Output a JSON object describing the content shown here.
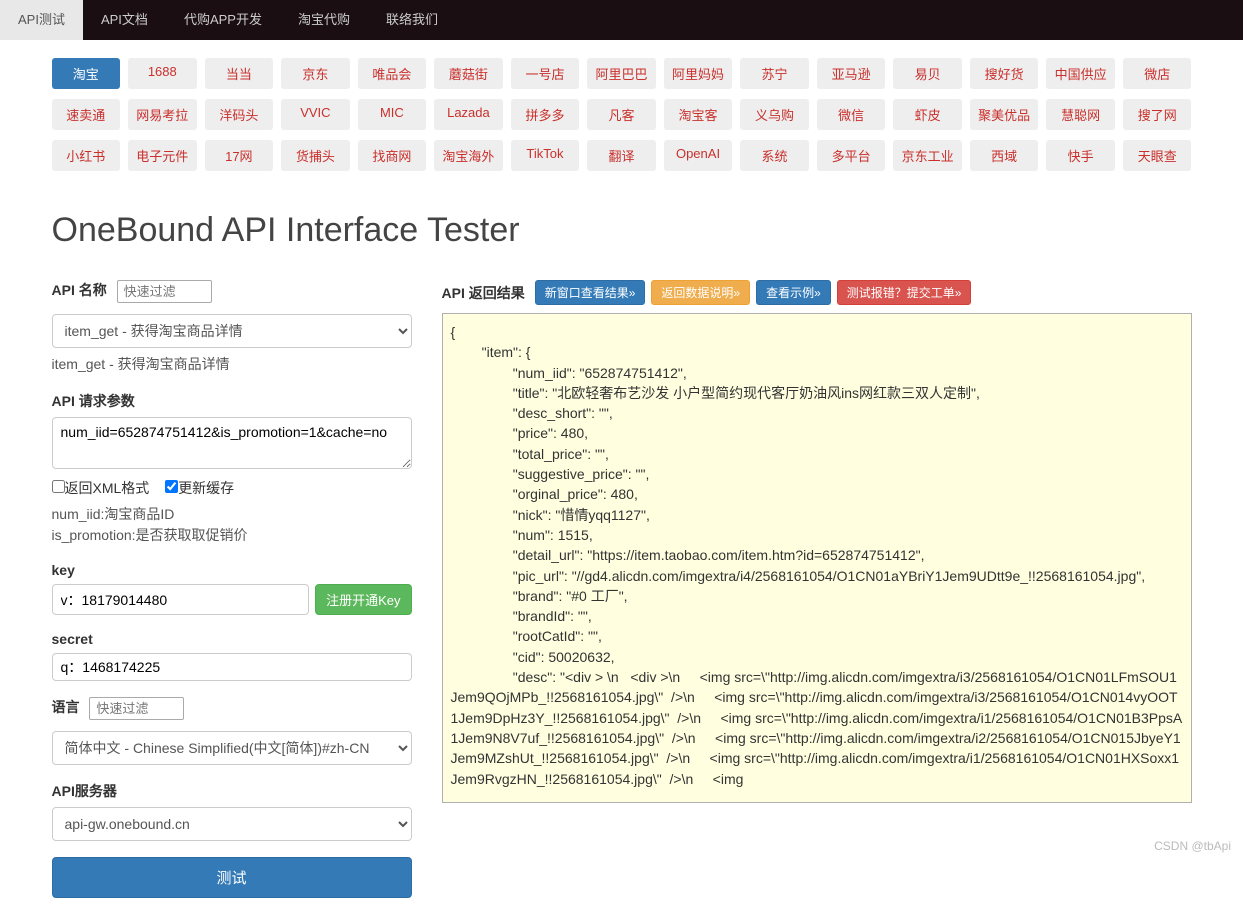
{
  "topnav": {
    "items": [
      "API测试",
      "API文档",
      "代购APP开发",
      "淘宝代购",
      "联络我们"
    ],
    "activeIndex": 0
  },
  "tags": {
    "rows": [
      [
        "淘宝",
        "1688",
        "当当",
        "京东",
        "唯品会",
        "蘑菇街",
        "一号店",
        "阿里巴巴",
        "阿里妈妈",
        "苏宁",
        "亚马逊",
        "易贝",
        "搜好货",
        "中国供应",
        "微店"
      ],
      [
        "速卖通",
        "网易考拉",
        "洋码头",
        "VVIC",
        "MIC",
        "Lazada",
        "拼多多",
        "凡客",
        "淘宝客",
        "义乌购",
        "微信",
        "虾皮",
        "聚美优品",
        "慧聪网",
        "搜了网"
      ],
      [
        "小红书",
        "电子元件",
        "17网",
        "货捕头",
        "找商网",
        "淘宝海外",
        "TikTok",
        "翻译",
        "OpenAI",
        "系统",
        "多平台",
        "京东工业",
        "西域",
        "快手",
        "天眼查"
      ]
    ],
    "activeRow": 0,
    "activeCol": 0
  },
  "title": "OneBound API Interface Tester",
  "form": {
    "apiNameLabel": "API 名称",
    "apiNamePlaceholder": "快速过滤",
    "apiSelectValue": "item_get - 获得淘宝商品详情",
    "apiSelectedText": "item_get - 获得淘宝商品详情",
    "paramsLabel": "API 请求参数",
    "paramsValue": "num_iid=652874751412&is_promotion=1&cache=no",
    "xmlLabel": "返回XML格式",
    "cacheLabel": "更新缓存",
    "xmlChecked": false,
    "cacheChecked": true,
    "paramHelp1": "num_iid:淘宝商品ID",
    "paramHelp2": "is_promotion:是否获取取促销价",
    "keyLabel": "key",
    "keyValue": "v：18179014480",
    "keyBtn": "注册开通Key",
    "secretLabel": "secret",
    "secretValue": "q：1468174225",
    "langLabel": "语言",
    "langPlaceholder": "快速过滤",
    "langSelectValue": "简体中文 - Chinese Simplified(中文[简体])#zh-CN",
    "serverLabel": "API服务器",
    "serverValue": "api-gw.onebound.cn",
    "submitBtn": "测试"
  },
  "result": {
    "label": "API 返回结果",
    "btn1": "新窗口查看结果»",
    "btn2": "返回数据说明»",
    "btn3": "查看示例»",
    "btn4": "测试报错？提交工单»",
    "body": "{\n        \"item\": {\n                \"num_iid\": \"652874751412\",\n                \"title\": \"北欧轻奢布艺沙发 小户型简约现代客厅奶油风ins网红款三双人定制\",\n                \"desc_short\": \"\",\n                \"price\": 480,\n                \"total_price\": \"\",\n                \"suggestive_price\": \"\",\n                \"orginal_price\": 480,\n                \"nick\": \"惜情yqq1127\",\n                \"num\": 1515,\n                \"detail_url\": \"https://item.taobao.com/item.htm?id=652874751412\",\n                \"pic_url\": \"//gd4.alicdn.com/imgextra/i4/2568161054/O1CN01aYBriY1Jem9UDtt9e_!!2568161054.jpg\",\n                \"brand\": \"#0 工厂\",\n                \"brandId\": \"\",\n                \"rootCatId\": \"\",\n                \"cid\": 50020632,\n                \"desc\": \"<div > \\n   <div >\\n     <img src=\\\"http://img.alicdn.com/imgextra/i3/2568161054/O1CN01LFmSOU1Jem9QOjMPb_!!2568161054.jpg\\\"  />\\n     <img src=\\\"http://img.alicdn.com/imgextra/i3/2568161054/O1CN014vyOOT1Jem9DpHz3Y_!!2568161054.jpg\\\"  />\\n     <img src=\\\"http://img.alicdn.com/imgextra/i1/2568161054/O1CN01B3PpsA1Jem9N8V7uf_!!2568161054.jpg\\\"  />\\n     <img src=\\\"http://img.alicdn.com/imgextra/i2/2568161054/O1CN015JbyeY1Jem9MZshUt_!!2568161054.jpg\\\"  />\\n     <img src=\\\"http://img.alicdn.com/imgextra/i1/2568161054/O1CN01HXSoxx1Jem9RvgzHN_!!2568161054.jpg\\\"  />\\n     <img"
  },
  "watermark": "CSDN @tbApi"
}
